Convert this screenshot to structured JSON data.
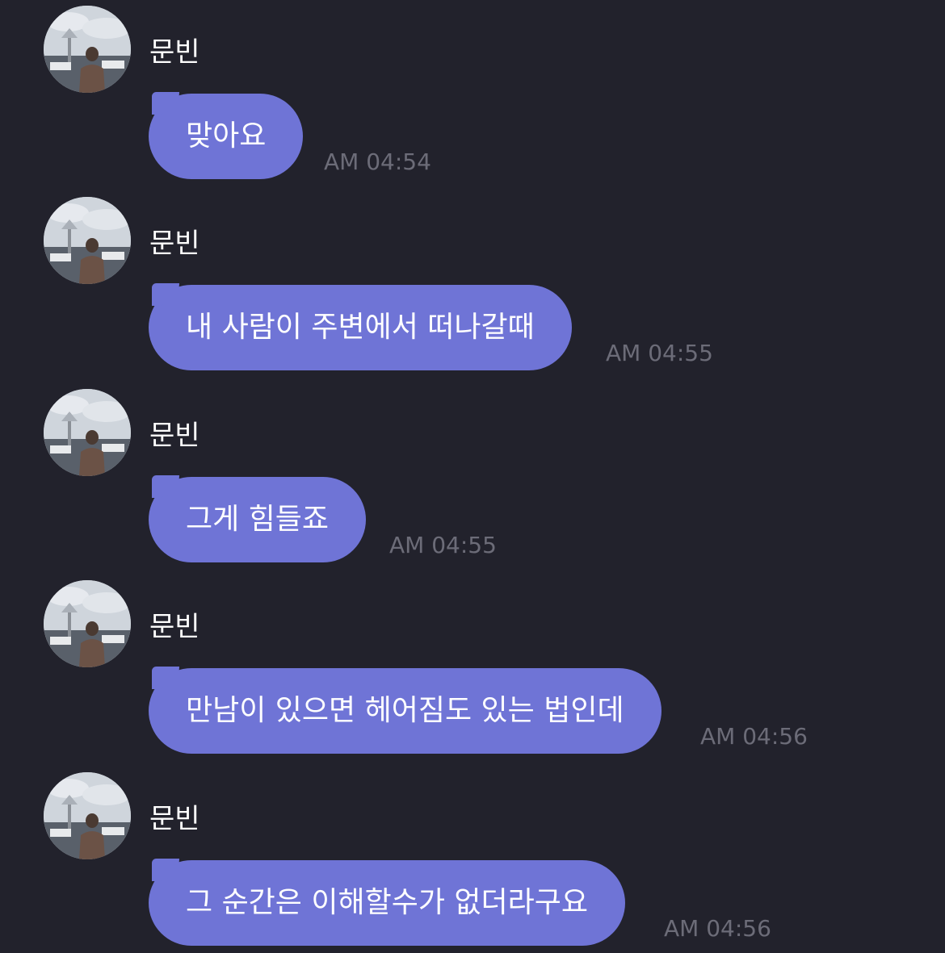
{
  "sender_name": "문빈",
  "messages": [
    {
      "text": "맞아요",
      "time": "AM 04:54"
    },
    {
      "text": "내 사람이 주변에서 떠나갈때",
      "time": "AM 04:55"
    },
    {
      "text": "그게 힘들죠",
      "time": "AM 04:55"
    },
    {
      "text": "만남이 있으면 헤어짐도 있는 법인데",
      "time": "AM 04:56"
    },
    {
      "text": "그 순간은 이해할수가 없더라구요",
      "time": "AM 04:56"
    }
  ],
  "colors": {
    "background": "#22222c",
    "bubble": "#6f74d6",
    "timestamp": "#6c6c78",
    "text": "#ffffff"
  }
}
